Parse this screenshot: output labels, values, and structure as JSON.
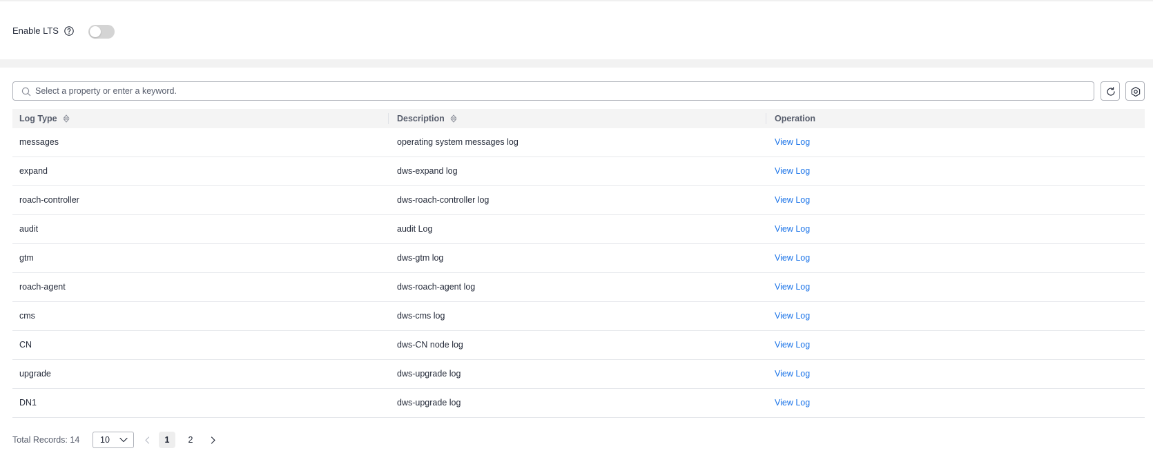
{
  "lts": {
    "label": "Enable LTS",
    "enabled": false
  },
  "search": {
    "placeholder": "Select a property or enter a keyword.",
    "value": ""
  },
  "table": {
    "columns": {
      "log_type": "Log Type",
      "description": "Description",
      "operation": "Operation"
    },
    "rows": [
      {
        "log_type": "messages",
        "description": "operating system messages log",
        "operation": "View Log"
      },
      {
        "log_type": "expand",
        "description": "dws-expand log",
        "operation": "View Log"
      },
      {
        "log_type": "roach-controller",
        "description": "dws-roach-controller log",
        "operation": "View Log"
      },
      {
        "log_type": "audit",
        "description": "audit Log",
        "operation": "View Log"
      },
      {
        "log_type": "gtm",
        "description": "dws-gtm log",
        "operation": "View Log"
      },
      {
        "log_type": "roach-agent",
        "description": "dws-roach-agent log",
        "operation": "View Log"
      },
      {
        "log_type": "cms",
        "description": "dws-cms log",
        "operation": "View Log"
      },
      {
        "log_type": "CN",
        "description": "dws-CN node log",
        "operation": "View Log"
      },
      {
        "log_type": "upgrade",
        "description": "dws-upgrade log",
        "operation": "View Log"
      },
      {
        "log_type": "DN1",
        "description": "dws-upgrade log",
        "operation": "View Log"
      }
    ]
  },
  "pagination": {
    "total_label": "Total Records: 14",
    "page_size": "10",
    "pages": [
      "1",
      "2"
    ],
    "current_page": "1"
  },
  "icons": {
    "help": "help-circle-icon",
    "search": "search-icon",
    "refresh": "refresh-icon",
    "settings": "gear-icon",
    "sort": "sort-icon",
    "chevron_down": "chevron-down-icon",
    "prev": "chevron-left-icon",
    "next": "chevron-right-icon"
  },
  "colors": {
    "link": "#1a73e8",
    "toggle_off": "#d4d4d4",
    "header_bg": "#f4f4f4"
  }
}
